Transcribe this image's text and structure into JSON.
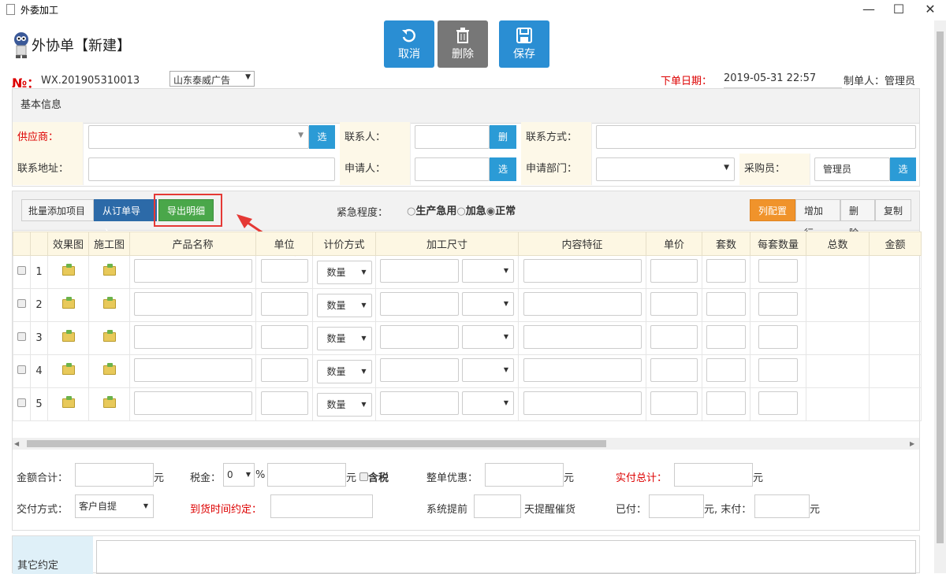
{
  "window": {
    "title": "外委加工",
    "min": "—",
    "max": "☐",
    "close": "✕"
  },
  "toolbar": {
    "cancel": "取消",
    "delete": "删除",
    "save": "保存"
  },
  "form_title": "外协单【新建】",
  "order": {
    "no_label": "№：",
    "no_value": "WX.201905310013",
    "company": "山东泰威广告",
    "date_label": "下单日期：",
    "date_value": "2019-05-31 22:57",
    "maker_label": "制单人：",
    "maker_value": "管理员"
  },
  "basic": {
    "title": "基本信息",
    "supplier_label": "供应商：",
    "contact_label": "联系人：",
    "contact_way_label": "联系方式：",
    "address_label": "联系地址：",
    "applicant_label": "申请人：",
    "dept_label": "申请部门：",
    "purchaser_label": "采购员：",
    "purchaser_value": "管理员",
    "pick": "选",
    "del": "删"
  },
  "detail_toolbar": {
    "batch_add": "批量添加项目",
    "import": "从订单导入",
    "export": "导出明细",
    "urgency_label": "紧急程度：",
    "urgency_options": [
      "生产急用",
      "加急",
      "正常"
    ],
    "col_config": "列配置",
    "add_row": "增加行",
    "delete": "删除",
    "copy": "复制"
  },
  "grid": {
    "columns": [
      "效果图",
      "施工图",
      "产品名称",
      "单位",
      "计价方式",
      "加工尺寸",
      "内容特征",
      "单价",
      "套数",
      "每套数量",
      "总数",
      "金额"
    ],
    "rows": [
      "1",
      "2",
      "3",
      "4",
      "5"
    ],
    "pricing_default": "数量"
  },
  "footer": {
    "amount_total": "金额合计：",
    "yuan": "元",
    "tax": "税金：",
    "tax_value": "0",
    "percent": "%",
    "tax_included": "含税",
    "discount": "整单优惠：",
    "actual_total": "实付总计：",
    "delivery": "交付方式：",
    "delivery_value": "客户自提",
    "arrival": "到货时间约定：",
    "remind_prefix": "系统提前",
    "remind_suffix": "天提醒催货",
    "paid": "已付：",
    "unpaid_sep": "元, 末付：",
    "other": "其它约定"
  }
}
